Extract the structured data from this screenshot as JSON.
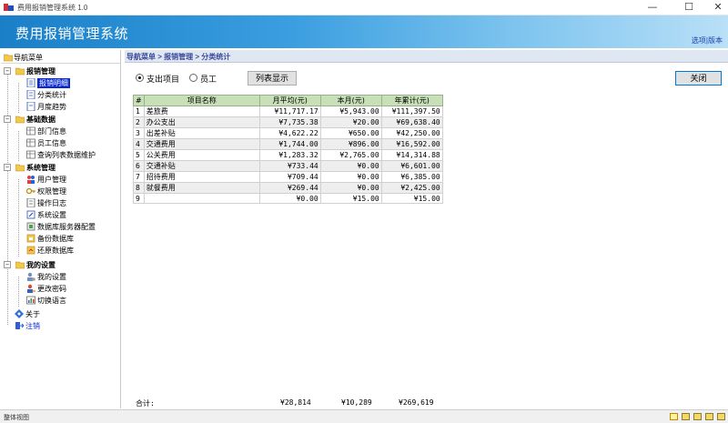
{
  "window": {
    "title": "费用报销管理系统 1.0"
  },
  "banner": {
    "app_name": "费用报销管理系统",
    "link": "选项|版本"
  },
  "nav": {
    "header": "导航菜单",
    "groups": [
      {
        "label": "报销管理",
        "items": [
          "报销明细",
          "分类统计",
          "月度趋势"
        ]
      },
      {
        "label": "基础数据",
        "items": [
          "部门信息",
          "员工信息",
          "查询列表数据维护"
        ]
      },
      {
        "label": "系统管理",
        "items": [
          "用户管理",
          "权限管理",
          "操作日志",
          "系统设置",
          "数据库服务器配置",
          "备份数据库",
          "还原数据库"
        ]
      },
      {
        "label": "我的设置",
        "items": [
          "我的设置",
          "更改密码",
          "切换语言"
        ]
      }
    ],
    "about": "关于",
    "logout": "注销"
  },
  "breadcrumb": "导航菜单 > 报销管理 > 分类统计",
  "options": {
    "radio_category": "支出项目",
    "radio_employee": "员工",
    "list_button": "列表显示",
    "close_button": "关闭"
  },
  "table": {
    "headers": [
      "#",
      "项目名称",
      "月平均(元)",
      "本月(元)",
      "年累计(元)"
    ],
    "rows": [
      [
        "1",
        "差旅费",
        "¥11,717.17",
        "¥5,943.00",
        "¥111,397.50"
      ],
      [
        "2",
        "办公支出",
        "¥7,735.38",
        "¥20.00",
        "¥69,638.40"
      ],
      [
        "3",
        "出差补贴",
        "¥4,622.22",
        "¥650.00",
        "¥42,250.00"
      ],
      [
        "4",
        "交通费用",
        "¥1,744.00",
        "¥896.00",
        "¥16,592.00"
      ],
      [
        "5",
        "公关费用",
        "¥1,283.32",
        "¥2,765.00",
        "¥14,314.88"
      ],
      [
        "6",
        "交通补贴",
        "¥733.44",
        "¥0.00",
        "¥6,601.00"
      ],
      [
        "7",
        "招待费用",
        "¥709.44",
        "¥0.00",
        "¥6,385.00"
      ],
      [
        "8",
        "就餐费用",
        "¥269.44",
        "¥0.00",
        "¥2,425.00"
      ],
      [
        "9",
        "",
        "¥0.00",
        "¥15.00",
        "¥15.00"
      ]
    ]
  },
  "totals": {
    "label": "合计:",
    "avg": "¥28,814",
    "month": "¥10,289",
    "year": "¥269,619"
  },
  "status": {
    "text": "整体视图"
  },
  "colors": {
    "accent": "#1a7fc7",
    "selected": "#0a2ad0",
    "header_green": "#c8e0b8"
  }
}
